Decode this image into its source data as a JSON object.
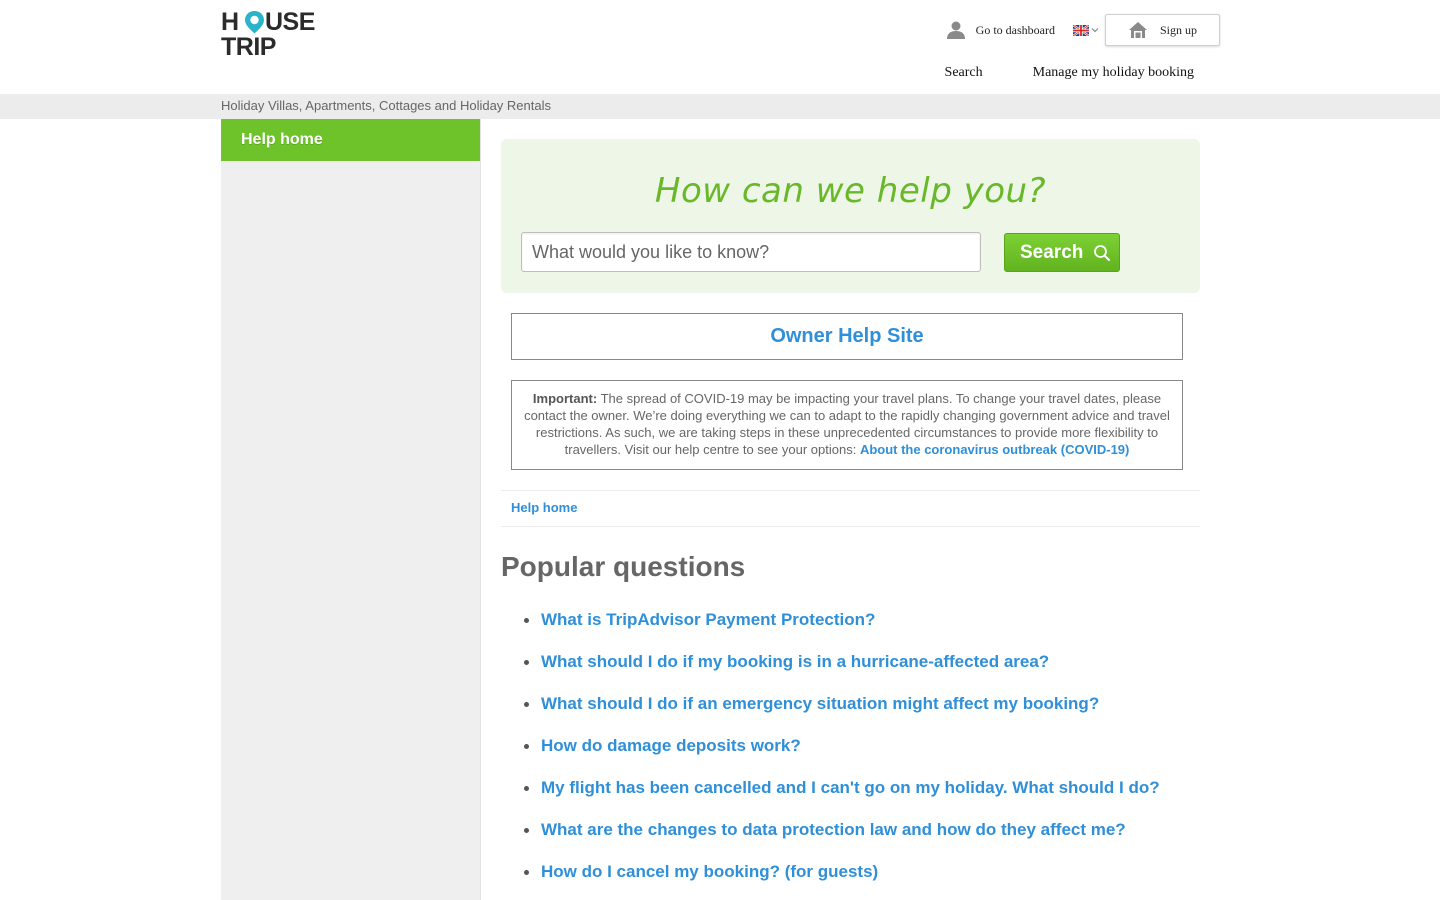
{
  "brand": {
    "logo_line1_a": "H",
    "logo_line1_b": "USE",
    "logo_line2": "TRIP",
    "pin_color": "#2ab3c9"
  },
  "header": {
    "dashboard_label": "Go to dashboard",
    "language_flag": "uk-flag-icon",
    "signup_label": "Sign up",
    "nav": {
      "search": "Search",
      "manage": "Manage my holiday booking"
    }
  },
  "subbar": {
    "text": "Holiday Villas, Apartments, Cottages and Holiday Rentals"
  },
  "sidebar": {
    "items": [
      {
        "label": "Help home"
      }
    ]
  },
  "hero": {
    "title": "How can we help you?",
    "search_placeholder": "What would you like to know?",
    "search_value": "",
    "search_button": "Search"
  },
  "owner_link": "Owner Help Site",
  "notice": {
    "label": "Important:",
    "text": " The spread of COVID-19 may be impacting your travel plans. To change your travel dates, please contact the owner. We’re doing everything we can to adapt to the rapidly changing government advice and travel restrictions. As such, we are taking steps in these unprecedented circumstances to provide more flexibility to travellers. Visit our help centre to see your options: ",
    "link": "About the coronavirus outbreak (COVID-19)"
  },
  "breadcrumb": {
    "home": "Help home"
  },
  "popular": {
    "title": "Popular questions",
    "questions": [
      "What is TripAdvisor Payment Protection?",
      "What should I do if my booking is in a hurricane-affected area?",
      "What should I do if an emergency situation might affect my booking?",
      "How do damage deposits work?",
      "My flight has been cancelled and I can't go on my holiday. What should I do?",
      "What are the changes to data protection law and how do they affect me?",
      "How do I cancel my booking? (for guests)"
    ]
  },
  "colors": {
    "accent_green": "#6ec32b",
    "link_blue": "#2f8fd8",
    "hero_bg": "#eef6e7"
  }
}
